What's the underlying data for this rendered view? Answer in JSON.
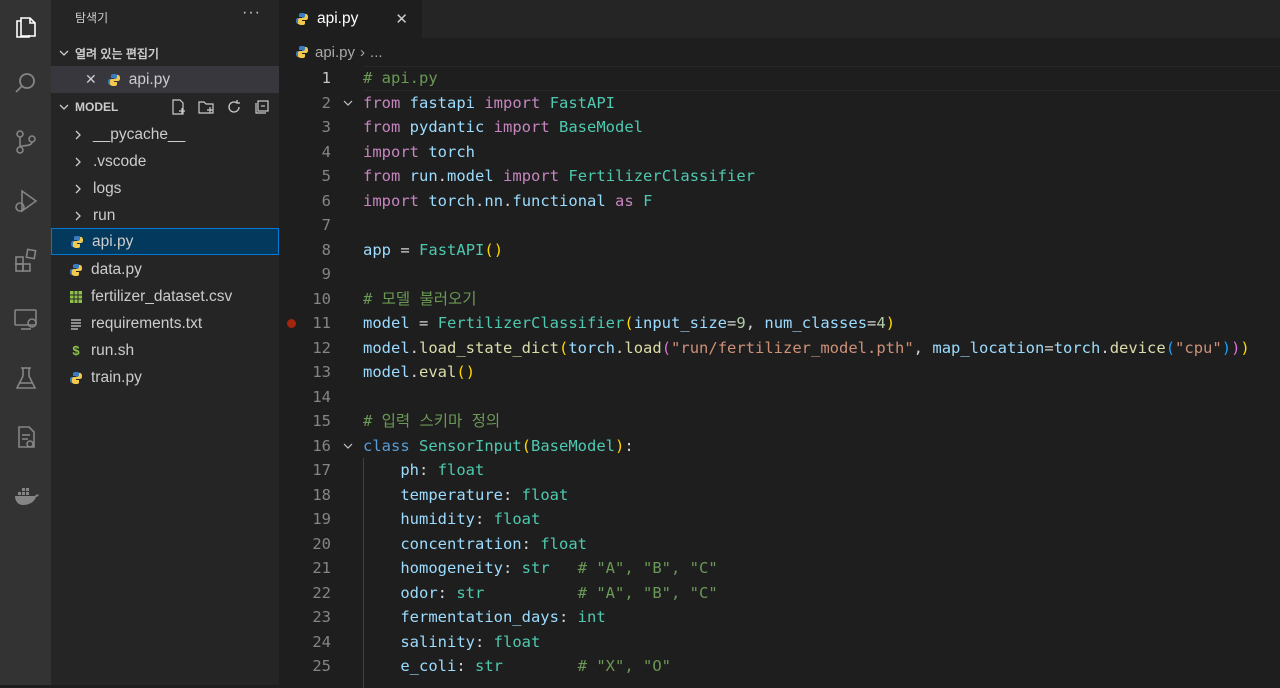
{
  "sidebar": {
    "title": "탐색기",
    "more": "···",
    "open_editors": {
      "label": "열려 있는 편집기",
      "items": [
        {
          "label": "api.py"
        }
      ]
    },
    "folder": {
      "label": "MODEL",
      "items": [
        {
          "label": "__pycache__"
        },
        {
          "label": ".vscode"
        },
        {
          "label": "logs"
        },
        {
          "label": "run"
        },
        {
          "label": "api.py"
        },
        {
          "label": "data.py"
        },
        {
          "label": "fertilizer_dataset.csv"
        },
        {
          "label": "requirements.txt"
        },
        {
          "label": "run.sh"
        },
        {
          "label": "train.py"
        }
      ]
    }
  },
  "tab": {
    "label": "api.py",
    "close": "✕"
  },
  "breadcrumb": {
    "file": "api.py",
    "sep": "›",
    "rest": "..."
  },
  "editor": {
    "line_numbers": [
      "1",
      "2",
      "3",
      "4",
      "5",
      "6",
      "7",
      "8",
      "9",
      "10",
      "11",
      "12",
      "13",
      "14",
      "15",
      "16",
      "17",
      "18",
      "19",
      "20",
      "21",
      "22",
      "23",
      "24",
      "25"
    ],
    "lines": [
      "# api.py",
      "from fastapi import FastAPI",
      "from pydantic import BaseModel",
      "import torch",
      "from run.model import FertilizerClassifier",
      "import torch.nn.functional as F",
      "",
      "app = FastAPI()",
      "",
      "# 모델 불러오기",
      "model = FertilizerClassifier(input_size=9, num_classes=4)",
      "model.load_state_dict(torch.load(\"run/fertilizer_model.pth\", map_location=torch.device(\"cpu\")))",
      "model.eval()",
      "",
      "# 입력 스키마 정의",
      "class SensorInput(BaseModel):",
      "    ph: float",
      "    temperature: float",
      "    humidity: float",
      "    concentration: float",
      "    homogeneity: str   # \"A\", \"B\", \"C\"",
      "    odor: str          # \"A\", \"B\", \"C\"",
      "    fermentation_days: int",
      "    salinity: float",
      "    e_coli: str        # \"X\", \"O\""
    ]
  },
  "icons": {
    "python": "python-file-icon",
    "csv": "table-file-icon",
    "txt": "text-lines-icon",
    "shell": "dollar-icon"
  },
  "colors": {
    "keyword": "#c586c0",
    "blue_keyword": "#569cd6",
    "variable": "#9cdcfe",
    "class": "#4ec9b0",
    "function": "#dcdcaa",
    "string": "#ce9178",
    "number": "#b5cea8",
    "comment": "#6a9955",
    "selection": "#04395e"
  }
}
